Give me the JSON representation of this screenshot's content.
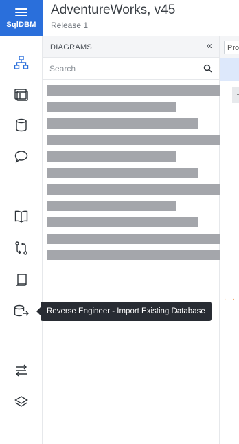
{
  "logo": {
    "text": "SqlDBM"
  },
  "header": {
    "title": "AdventureWorks, v45",
    "subtitle": "Release 1"
  },
  "rail": {
    "items": [
      {
        "icon": "diagram-tree-icon",
        "active": true
      },
      {
        "icon": "table-grid-icon"
      },
      {
        "icon": "database-icon"
      },
      {
        "icon": "comment-icon"
      },
      {
        "icon": "book-icon"
      },
      {
        "icon": "compare-arrows-icon"
      },
      {
        "icon": "document-icon"
      },
      {
        "icon": "reverse-engineer-db-icon"
      },
      {
        "icon": "export-arrows-icon"
      },
      {
        "icon": "layers-icon"
      }
    ]
  },
  "panel": {
    "title": "DIAGRAMS",
    "collapse_glyph": "«",
    "search_placeholder": "Search",
    "loading_rows": 11
  },
  "canvas": {
    "tab_text": "Pro"
  },
  "tooltip": {
    "text": "Reverse Engineer - Import Existing Database"
  },
  "colors": {
    "brand": "#2a6fdb",
    "icon": "#2d3339",
    "active_icon": "#2a6fdb",
    "skeleton": "#a4a6ab",
    "tooltip_bg": "#282c33"
  }
}
